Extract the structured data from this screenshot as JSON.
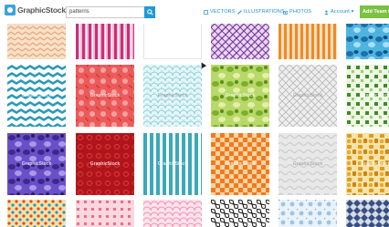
{
  "header": {
    "logo_text": "GraphicStock",
    "search_value": "patterns",
    "nav": {
      "vectors": "VECTORS",
      "illustrations": "ILLUSTRATIONS",
      "photos": "PHOTOS",
      "account": "Account ▾"
    },
    "trial_button": "Add Team Me"
  },
  "watermark": "GraphicStock",
  "tiles": [
    {
      "row": 0,
      "col": 0,
      "pattern": "zigzag-peach"
    },
    {
      "row": 0,
      "col": 1,
      "pattern": "stripes-pink"
    },
    {
      "row": 0,
      "col": 2,
      "pattern": "blank"
    },
    {
      "row": 0,
      "col": 3,
      "pattern": "diag-plaid-purple"
    },
    {
      "row": 0,
      "col": 4,
      "pattern": "stripes-orange"
    },
    {
      "row": 0,
      "col": 5,
      "pattern": "camo-blue"
    },
    {
      "row": 1,
      "col": 0,
      "pattern": "waves-teal"
    },
    {
      "row": 1,
      "col": 1,
      "pattern": "floral-red"
    },
    {
      "row": 1,
      "col": 2,
      "pattern": "scales-cyan"
    },
    {
      "row": 1,
      "col": 3,
      "pattern": "camo-green"
    },
    {
      "row": 1,
      "col": 4,
      "pattern": "diamond-gray"
    },
    {
      "row": 1,
      "col": 5,
      "pattern": "squares-green"
    },
    {
      "row": 2,
      "col": 0,
      "pattern": "camo-purple"
    },
    {
      "row": 2,
      "col": 1,
      "pattern": "swirl-red"
    },
    {
      "row": 2,
      "col": 2,
      "pattern": "stripes-teal"
    },
    {
      "row": 2,
      "col": 3,
      "pattern": "checker-orange"
    },
    {
      "row": 2,
      "col": 4,
      "pattern": "waves-silver"
    },
    {
      "row": 2,
      "col": 5,
      "pattern": "giraffe"
    },
    {
      "row": 3,
      "col": 0,
      "pattern": "dots-multi"
    },
    {
      "row": 3,
      "col": 1,
      "pattern": "squares-pink"
    },
    {
      "row": 3,
      "col": 2,
      "pattern": "scales-pink"
    },
    {
      "row": 3,
      "col": 3,
      "pattern": "cells-black"
    },
    {
      "row": 3,
      "col": 4,
      "pattern": "floral-blue"
    },
    {
      "row": 3,
      "col": 5,
      "pattern": "diamond-navy"
    }
  ]
}
